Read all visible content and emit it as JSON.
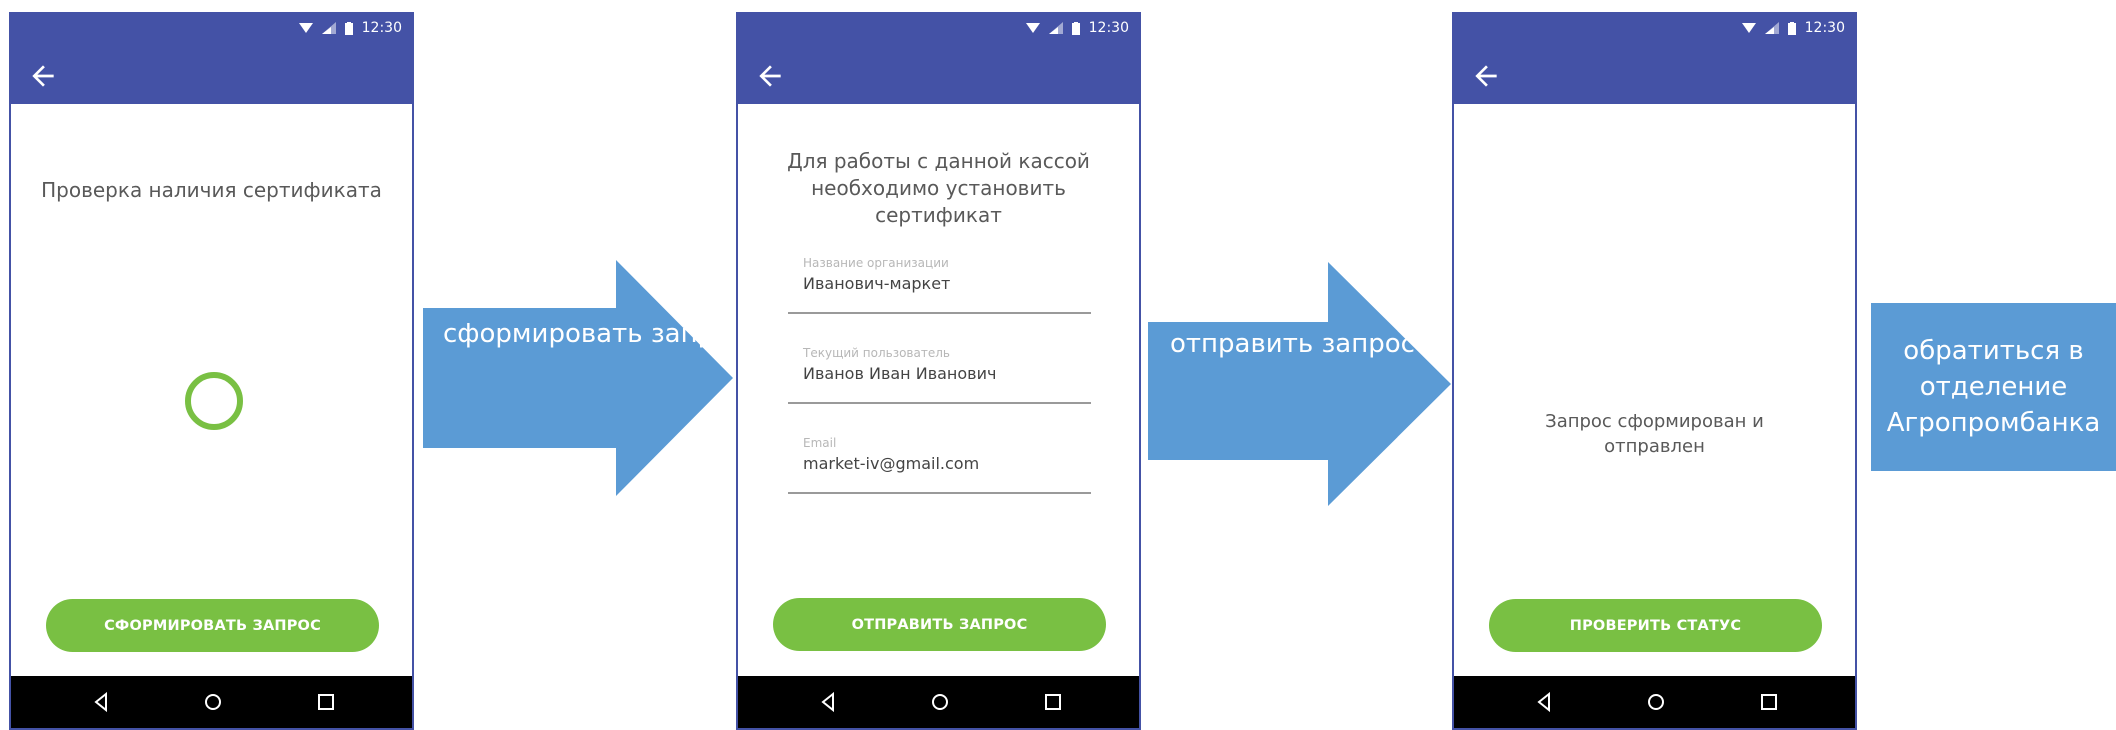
{
  "status_bar": {
    "time": "12:30"
  },
  "screens": [
    {
      "title": "Проверка наличия сертификата",
      "button_label": "СФОРМИРОВАТЬ ЗАПРОС"
    },
    {
      "title": "Для работы с данной кассой необходимо установить сертификат",
      "fields": [
        {
          "label": "Название организации",
          "value": "Иванович-маркет"
        },
        {
          "label": "Текущий пользователь",
          "value": "Иванов Иван Иванович"
        },
        {
          "label": "Email",
          "value": "market-iv@gmail.com"
        }
      ],
      "button_label": "ОТПРАВИТЬ ЗАПРОС"
    },
    {
      "message": "Запрос сформирован и отправлен",
      "button_label": "ПРОВЕРИТЬ СТАТУС"
    }
  ],
  "flow_steps": [
    "сформировать запрос сертификата",
    "отправить запрос в ОФД",
    "обратиться в отделение Агропромбанка"
  ],
  "colors": {
    "appbar": "#4452a6",
    "accent": "#79c043",
    "arrow": "#5b9bd5"
  },
  "icons": [
    "back-arrow-icon",
    "wifi-icon",
    "signal-icon",
    "battery-icon",
    "nav-back-icon",
    "nav-home-icon",
    "nav-recents-icon"
  ]
}
